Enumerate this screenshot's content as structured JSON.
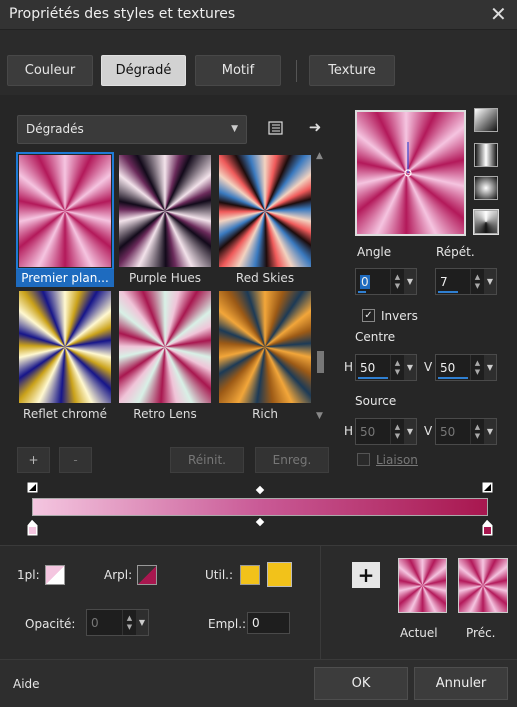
{
  "window": {
    "title": "Propriétés des styles et textures",
    "close_glyph": "✕"
  },
  "tabs": [
    "Couleur",
    "Dégradé",
    "Motif",
    "Texture"
  ],
  "active_tab": "Dégradé",
  "gradient_dropdown": {
    "value": "Dégradés"
  },
  "gradients": [
    {
      "name": "Premier plan...",
      "selected": true
    },
    {
      "name": "Purple Hues",
      "selected": false
    },
    {
      "name": "Red Skies",
      "selected": false
    },
    {
      "name": "Reflet chromé",
      "selected": false
    },
    {
      "name": "Retro Lens",
      "selected": false
    },
    {
      "name": "Rich",
      "selected": false
    }
  ],
  "gradient_buttons": {
    "add": "+",
    "remove": "-",
    "reset": "Réinit.",
    "save": "Enreg."
  },
  "angle": {
    "label": "Angle",
    "value": "0"
  },
  "repeat": {
    "label": "Répét.",
    "value": "7"
  },
  "invert": {
    "label": "Invers",
    "checked": true
  },
  "center": {
    "label": "Centre",
    "h_label": "H",
    "h": "50",
    "v_label": "V",
    "v": "50"
  },
  "source": {
    "label": "Source",
    "h_label": "H",
    "h": "50",
    "v_label": "V",
    "v": "50"
  },
  "link": {
    "label": "Liaison",
    "checked": false
  },
  "stop_controls": {
    "fg_label": "1pl:",
    "bg_label": "Arpl:",
    "user_label": "Util.:",
    "opacity_label": "Opacité:",
    "opacity_value": "0",
    "location_label": "Empl.:",
    "location_value": "0",
    "user_color": "#f2c21a"
  },
  "compare": {
    "current_label": "Actuel",
    "previous_label": "Préc.",
    "add_glyph": "+"
  },
  "footer": {
    "help": "Aide",
    "ok": "OK",
    "cancel": "Annuler"
  },
  "colors": {
    "accent": "#1e7bd6",
    "gradient_start": "#f4c6e0",
    "gradient_end": "#a8174f"
  }
}
